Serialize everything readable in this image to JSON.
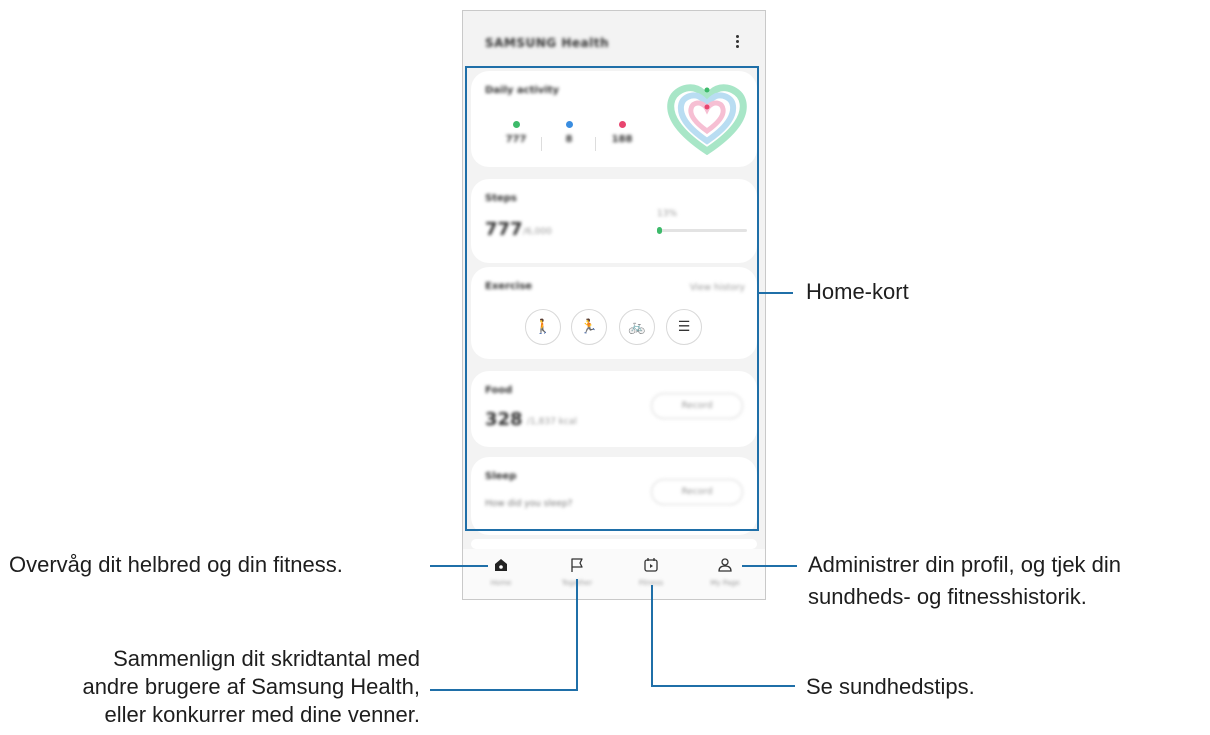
{
  "app": {
    "title": "SAMSUNG Health",
    "more_icon": "more-vertical-icon"
  },
  "cards": {
    "daily_activity": {
      "title": "Daily activity",
      "stats": [
        {
          "icon": "steps-icon",
          "color": "#3dba6a",
          "value": "777"
        },
        {
          "icon": "clock-icon",
          "color": "#3a8de0",
          "value": "8"
        },
        {
          "icon": "flame-icon",
          "color": "#e8456f",
          "value": "188"
        }
      ],
      "rings": {
        "outer": "#a8e6c7",
        "middle": "#b9ddf2",
        "inner": "#f6bfd3"
      }
    },
    "steps": {
      "title": "Steps",
      "value": "777",
      "goal": "/6,000",
      "percent": "13%",
      "progress": 0.06
    },
    "exercise": {
      "title": "Exercise",
      "history_label": "View history",
      "buttons": [
        {
          "name": "walking",
          "icon": "walking-icon",
          "glyph": "🚶"
        },
        {
          "name": "running",
          "icon": "running-icon",
          "glyph": "🏃"
        },
        {
          "name": "cycling",
          "icon": "bicycle-icon",
          "glyph": "🚲"
        },
        {
          "name": "list",
          "icon": "list-icon",
          "glyph": "☰"
        }
      ]
    },
    "food": {
      "title": "Food",
      "value": "328",
      "unit": "/1,837 kcal",
      "button": "Record"
    },
    "sleep": {
      "title": "Sleep",
      "question": "How did you sleep?",
      "button": "Record"
    }
  },
  "nav": [
    {
      "label": "Home",
      "icon": "home-icon"
    },
    {
      "label": "Together",
      "icon": "flag-icon"
    },
    {
      "label": "Fitness",
      "icon": "play-calendar-icon"
    },
    {
      "label": "My Page",
      "icon": "person-icon"
    }
  ],
  "callouts": {
    "home_cards": "Home-kort",
    "monitor": "Overvåg dit helbred og din fitness.",
    "profile_line1": "Administrer din profil, og tjek din",
    "profile_line2": "sundheds- og fitnesshistorik.",
    "compare_line1": "Sammenlign dit skridtantal med",
    "compare_line2": "andre brugere af Samsung Health,",
    "compare_line3": "eller konkurrer med dine venner.",
    "tips": "Se sundhedstips."
  },
  "colors": {
    "callout_line": "#1f6fa8",
    "steps_green": "#3dba6a"
  }
}
